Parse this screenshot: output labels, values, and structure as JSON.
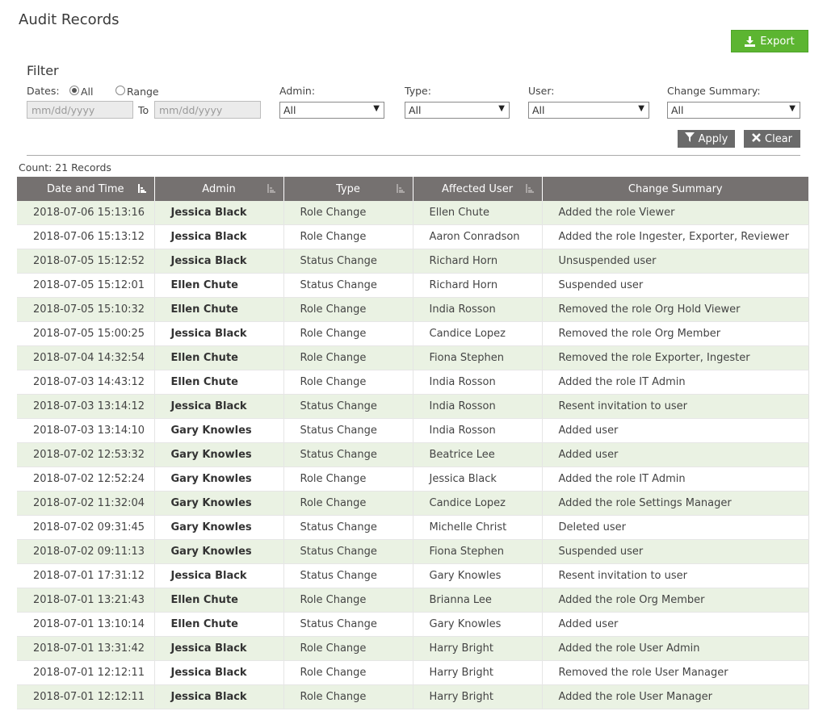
{
  "page": {
    "title": "Audit Records"
  },
  "toolbar": {
    "export_label": "Export"
  },
  "filter": {
    "title": "Filter",
    "dates_label": "Dates:",
    "all_label": "All",
    "range_label": "Range",
    "selected_range": "All",
    "start_placeholder": "mm/dd/yyyy",
    "to_label": "To",
    "end_placeholder": "mm/dd/yyyy",
    "admin": {
      "label": "Admin:",
      "value": "All"
    },
    "type": {
      "label": "Type:",
      "value": "All"
    },
    "user": {
      "label": "User:",
      "value": "All"
    },
    "change_summary": {
      "label": "Change Summary:",
      "value": "All"
    },
    "apply_label": "Apply",
    "clear_label": "Clear"
  },
  "count_text": "Count: 21 Records",
  "table": {
    "columns": [
      "Date and Time",
      "Admin",
      "Type",
      "Affected User",
      "Change Summary"
    ],
    "rows": [
      [
        "2018-07-06 15:13:16",
        "Jessica Black",
        "Role Change",
        "Ellen Chute",
        "Added the role Viewer"
      ],
      [
        "2018-07-06 15:13:12",
        "Jessica Black",
        "Role Change",
        "Aaron Conradson",
        "Added the role Ingester, Exporter, Reviewer"
      ],
      [
        "2018-07-05 15:12:52",
        "Jessica Black",
        "Status Change",
        "Richard Horn",
        "Unsuspended user"
      ],
      [
        "2018-07-05 15:12:01",
        "Ellen Chute",
        "Status Change",
        "Richard Horn",
        "Suspended user"
      ],
      [
        "2018-07-05 15:10:32",
        "Ellen Chute",
        "Role Change",
        "India Rosson",
        "Removed the role Org Hold Viewer"
      ],
      [
        "2018-07-05 15:00:25",
        "Jessica Black",
        "Role Change",
        "Candice Lopez",
        "Removed the role Org Member"
      ],
      [
        "2018-07-04 14:32:54",
        "Ellen Chute",
        "Role Change",
        "Fiona Stephen",
        "Removed the role Exporter, Ingester"
      ],
      [
        "2018-07-03 14:43:12",
        "Ellen Chute",
        "Role Change",
        "India Rosson",
        "Added the role IT Admin"
      ],
      [
        "2018-07-03 13:14:12",
        "Jessica Black",
        "Status Change",
        "India Rosson",
        "Resent invitation to user"
      ],
      [
        "2018-07-03 13:14:10",
        "Gary Knowles",
        "Status Change",
        "India Rosson",
        "Added user"
      ],
      [
        "2018-07-02 12:53:32",
        "Gary Knowles",
        "Status Change",
        "Beatrice Lee",
        "Added user"
      ],
      [
        "2018-07-02 12:52:24",
        "Gary Knowles",
        "Role Change",
        "Jessica Black",
        "Added the role IT Admin"
      ],
      [
        "2018-07-02 11:32:04",
        "Gary Knowles",
        "Role Change",
        "Candice Lopez",
        "Added the role Settings Manager"
      ],
      [
        "2018-07-02 09:31:45",
        "Gary Knowles",
        "Status Change",
        "Michelle Christ",
        "Deleted user"
      ],
      [
        "2018-07-02 09:11:13",
        "Gary Knowles",
        "Status Change",
        "Fiona Stephen",
        "Suspended user"
      ],
      [
        "2018-07-01 17:31:12",
        "Jessica Black",
        "Status Change",
        "Gary Knowles",
        "Resent invitation to user"
      ],
      [
        "2018-07-01 13:21:43",
        "Ellen Chute",
        "Role Change",
        "Brianna Lee",
        "Added the role Org Member"
      ],
      [
        "2018-07-01 13:10:14",
        "Ellen Chute",
        "Status Change",
        "Gary Knowles",
        "Added user"
      ],
      [
        "2018-07-01 13:31:42",
        "Jessica Black",
        "Role Change",
        "Harry Bright",
        "Added the role User Admin"
      ],
      [
        "2018-07-01 12:12:11",
        "Jessica Black",
        "Role Change",
        "Harry Bright",
        "Removed the role User Manager"
      ],
      [
        "2018-07-01 12:12:11",
        "Jessica Black",
        "Role Change",
        "Harry Bright",
        "Added the role User Manager"
      ]
    ]
  },
  "colors": {
    "accent_green": "#5cb531",
    "header_gray": "#757170",
    "row_stripe": "#eaf2e3",
    "button_gray": "#6a6a6a"
  },
  "icons": {
    "export": "download-icon",
    "apply": "filter-icon",
    "clear": "x-icon",
    "sort": "sort-icon"
  }
}
